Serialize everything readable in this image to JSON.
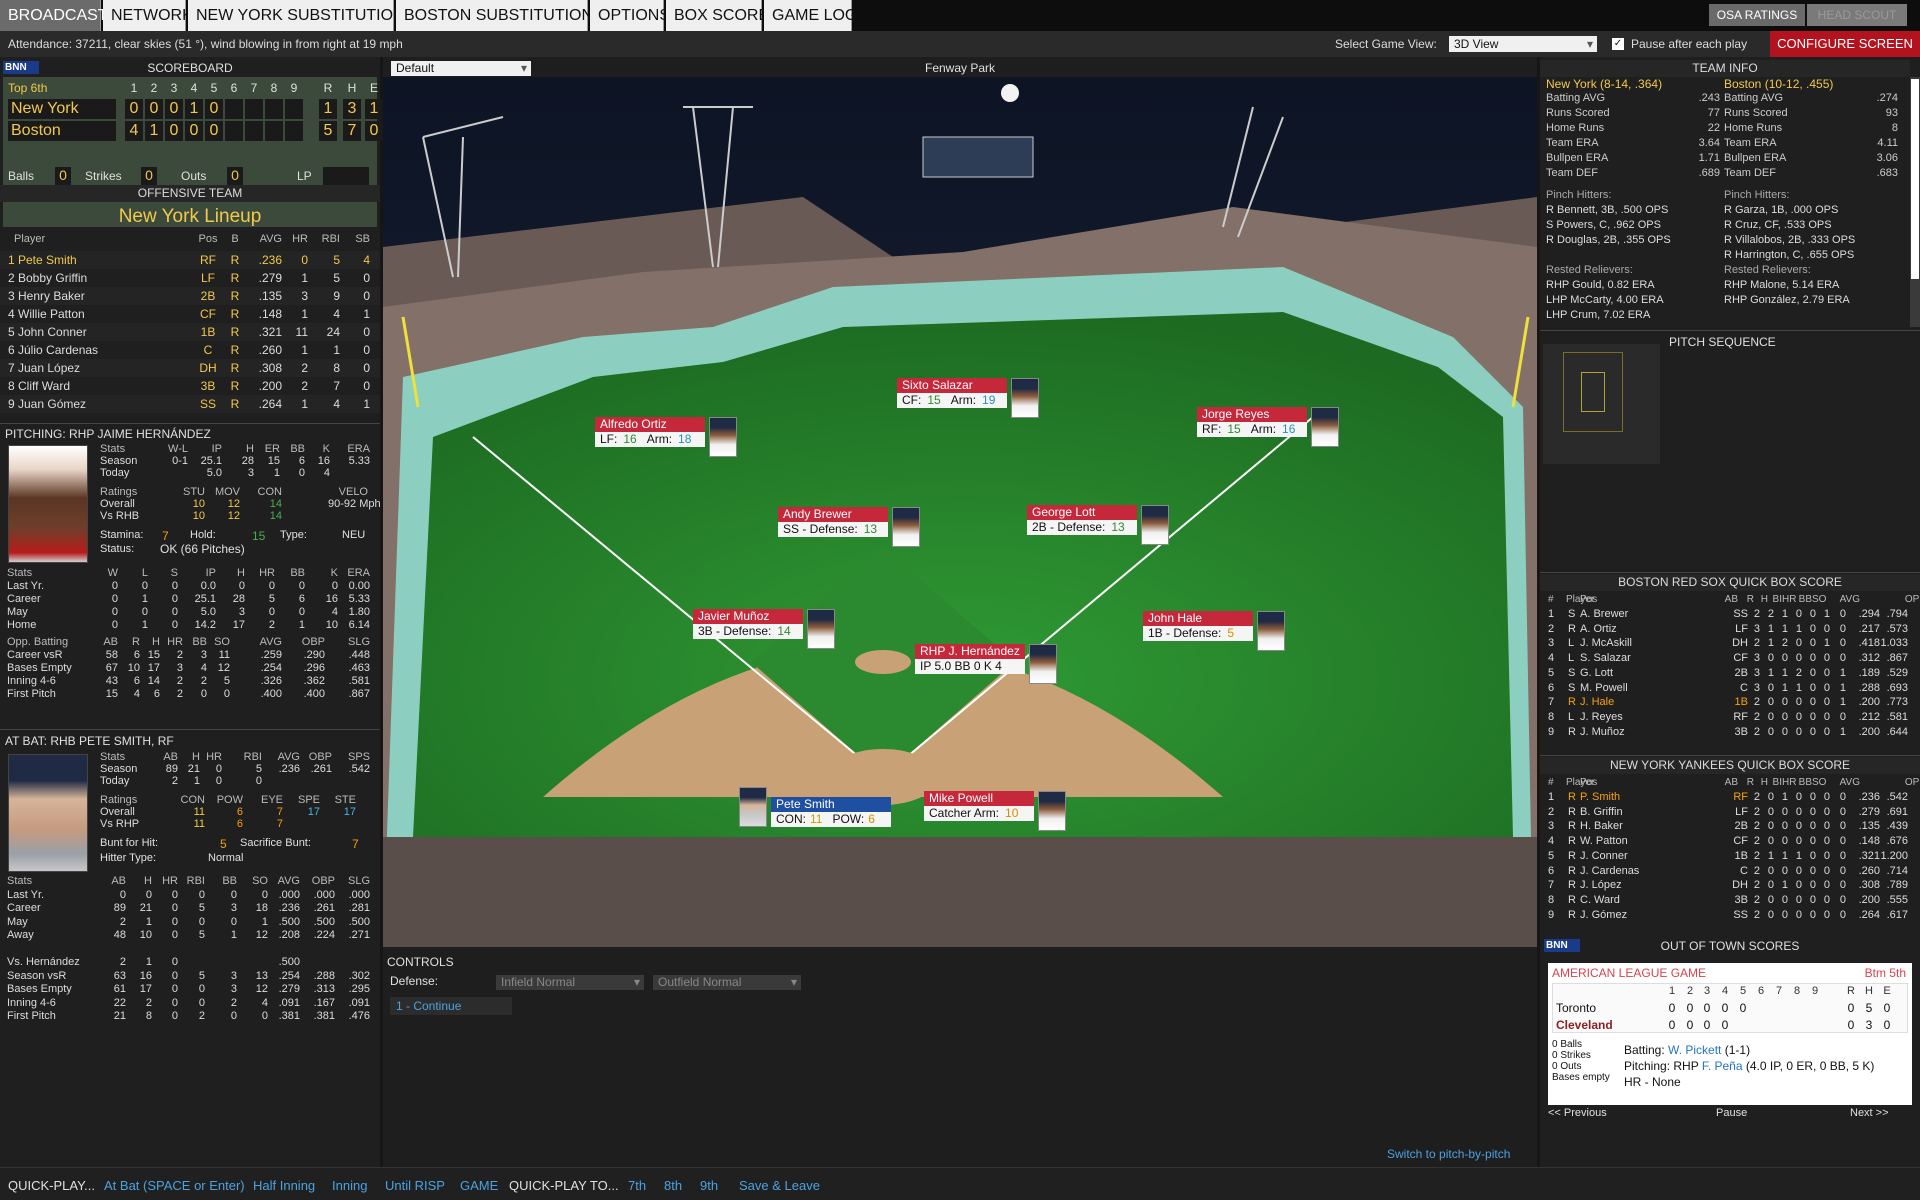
{
  "nav": {
    "tabs": [
      "BROADCAST",
      "NETWORK",
      "NEW YORK SUBSTITUTIONS",
      "BOSTON SUBSTITUTIONS",
      "OPTIONS",
      "BOX SCORE",
      "GAME LOG"
    ],
    "osa": "OSA RATINGS",
    "headscout": "HEAD SCOUT"
  },
  "attendance": "Attendance: 37211, clear skies (51 °), wind blowing in from right at 19 mph",
  "view": {
    "label": "Select Game View:",
    "value": "3D View",
    "pause": "Pause after each play",
    "configure": "CONFIGURE SCREEN"
  },
  "field": {
    "preset": "Default",
    "title": "Fenway Park"
  },
  "logo": "BNN",
  "scoreboard": {
    "title": "SCOREBOARD",
    "inning": "Top 6th",
    "cols": [
      "1",
      "2",
      "3",
      "4",
      "5",
      "6",
      "7",
      "8",
      "9",
      "R",
      "H",
      "E"
    ],
    "teams": [
      {
        "name": "New York",
        "runs": [
          "0",
          "0",
          "0",
          "1",
          "0",
          "",
          "",
          "",
          ""
        ],
        "rhe": [
          "1",
          "3",
          "1"
        ]
      },
      {
        "name": "Boston",
        "runs": [
          "4",
          "1",
          "0",
          "0",
          "0",
          "",
          "",
          "",
          ""
        ],
        "rhe": [
          "5",
          "7",
          "0"
        ]
      }
    ],
    "balls_l": "Balls",
    "balls": "0",
    "strikes_l": "Strikes",
    "strikes": "0",
    "outs_l": "Outs",
    "outs": "0",
    "lp": "LP"
  },
  "offense": {
    "title": "OFFENSIVE TEAM",
    "team": "New York Lineup",
    "cols": [
      "Player",
      "Pos",
      "B",
      "AVG",
      "HR",
      "RBI",
      "SB"
    ],
    "rows": [
      [
        "1 Pete Smith",
        "RF",
        "R",
        ".236",
        "0",
        "5",
        "4"
      ],
      [
        "2 Bobby Griffin",
        "LF",
        "R",
        ".279",
        "1",
        "5",
        "0"
      ],
      [
        "3 Henry Baker",
        "2B",
        "R",
        ".135",
        "3",
        "9",
        "0"
      ],
      [
        "4 Willie Patton",
        "CF",
        "R",
        ".148",
        "1",
        "4",
        "1"
      ],
      [
        "5 John Conner",
        "1B",
        "R",
        ".321",
        "11",
        "24",
        "0"
      ],
      [
        "6 Júlio Cardenas",
        "C",
        "R",
        ".260",
        "1",
        "1",
        "0"
      ],
      [
        "7 Juan López",
        "DH",
        "R",
        ".308",
        "2",
        "8",
        "0"
      ],
      [
        "8 Cliff Ward",
        "3B",
        "R",
        ".200",
        "2",
        "7",
        "0"
      ],
      [
        "9 Juan Gómez",
        "SS",
        "R",
        ".264",
        "1",
        "4",
        "1"
      ]
    ]
  },
  "pitching": {
    "title": "PITCHING: RHP JAIME HERNÁNDEZ",
    "s_cols": [
      "Stats",
      "W-L",
      "IP",
      "H",
      "ER",
      "BB",
      "K",
      "ERA"
    ],
    "s_rows": [
      [
        "Season",
        "0-1",
        "25.1",
        "28",
        "15",
        "6",
        "16",
        "5.33"
      ],
      [
        "Today",
        "",
        "5.0",
        "3",
        "1",
        "0",
        "4",
        ""
      ]
    ],
    "r_cols": [
      "Ratings",
      "STU",
      "MOV",
      "CON",
      "VELO"
    ],
    "r_rows": [
      [
        "Overall",
        "10",
        "12",
        "14",
        "90-92 Mph"
      ],
      [
        "Vs RHB",
        "10",
        "12",
        "14",
        ""
      ]
    ],
    "stamina_l": "Stamina:",
    "stamina": "7",
    "hold_l": "Hold:",
    "hold": "15",
    "type_l": "Type:",
    "type": "NEU",
    "status_l": "Status:",
    "status": "OK (66 Pitches)",
    "st_cols": [
      "Stats",
      "W",
      "L",
      "S",
      "IP",
      "H",
      "HR",
      "BB",
      "K",
      "ERA"
    ],
    "st_rows": [
      [
        "Last Yr.",
        "0",
        "0",
        "0",
        "0.0",
        "0",
        "0",
        "0",
        "0",
        "0.00"
      ],
      [
        "Career",
        "0",
        "1",
        "0",
        "25.1",
        "28",
        "5",
        "6",
        "16",
        "5.33"
      ],
      [
        "May",
        "0",
        "0",
        "0",
        "5.0",
        "3",
        "0",
        "0",
        "4",
        "1.80"
      ],
      [
        "Home",
        "0",
        "1",
        "0",
        "14.2",
        "17",
        "2",
        "1",
        "10",
        "6.14"
      ]
    ],
    "ob_cols": [
      "Opp. Batting",
      "AB",
      "R",
      "H",
      "HR",
      "BB",
      "SO",
      "AVG",
      "OBP",
      "SLG"
    ],
    "ob_rows": [
      [
        "Career vsR",
        "58",
        "6",
        "15",
        "2",
        "3",
        "11",
        ".259",
        ".290",
        ".448"
      ],
      [
        "Bases Empty",
        "67",
        "10",
        "17",
        "3",
        "4",
        "12",
        ".254",
        ".296",
        ".463"
      ],
      [
        "Inning 4-6",
        "43",
        "6",
        "14",
        "2",
        "2",
        "5",
        ".326",
        ".362",
        ".581"
      ],
      [
        "First Pitch",
        "15",
        "4",
        "6",
        "2",
        "0",
        "0",
        ".400",
        ".400",
        ".867"
      ]
    ]
  },
  "atbat": {
    "title": "AT BAT: RHB PETE SMITH, RF",
    "s_cols": [
      "Stats",
      "AB",
      "H",
      "HR",
      "RBI",
      "AVG",
      "OBP",
      "SPS"
    ],
    "s_rows": [
      [
        "Season",
        "89",
        "21",
        "0",
        "5",
        ".236",
        ".261",
        ".542"
      ],
      [
        "Today",
        "2",
        "1",
        "0",
        "0",
        "",
        "",
        ""
      ]
    ],
    "r_cols": [
      "Ratings",
      "CON",
      "POW",
      "EYE",
      "SPE",
      "STE"
    ],
    "r_rows": [
      [
        "Overall",
        "11",
        "6",
        "7",
        "17",
        "17"
      ],
      [
        "Vs RHP",
        "11",
        "6",
        "7",
        "",
        ""
      ]
    ],
    "bunt_l": "Bunt for Hit:",
    "bunt": "5",
    "sac_l": "Sacrifice Bunt:",
    "sac": "7",
    "ht_l": "Hitter Type:",
    "ht": "Normal",
    "st_cols": [
      "Stats",
      "AB",
      "H",
      "HR",
      "RBI",
      "BB",
      "SO",
      "AVG",
      "OBP",
      "SLG"
    ],
    "st_rows": [
      [
        "Last Yr.",
        "0",
        "0",
        "0",
        "0",
        "0",
        "0",
        ".000",
        ".000",
        ".000"
      ],
      [
        "Career",
        "89",
        "21",
        "0",
        "5",
        "3",
        "18",
        ".236",
        ".261",
        ".281"
      ],
      [
        "May",
        "2",
        "1",
        "0",
        "0",
        "0",
        "1",
        ".500",
        ".500",
        ".500"
      ],
      [
        "Away",
        "48",
        "10",
        "0",
        "5",
        "1",
        "12",
        ".208",
        ".224",
        ".271"
      ],
      [
        "",
        "",
        "",
        "",
        "",
        "",
        "",
        "",
        "",
        ""
      ],
      [
        "Vs. Hernández",
        "2",
        "1",
        "0",
        "",
        "",
        "",
        ".500",
        "",
        ""
      ],
      [
        "Season vsR",
        "63",
        "16",
        "0",
        "5",
        "3",
        "13",
        ".254",
        ".288",
        ".302"
      ],
      [
        "Bases Empty",
        "61",
        "17",
        "0",
        "0",
        "3",
        "12",
        ".279",
        ".313",
        ".295"
      ],
      [
        "Inning 4-6",
        "22",
        "2",
        "0",
        "0",
        "2",
        "4",
        ".091",
        ".167",
        ".091"
      ],
      [
        "First Pitch",
        "21",
        "8",
        "0",
        "2",
        "0",
        "0",
        ".381",
        ".381",
        ".476"
      ]
    ]
  },
  "fielders": [
    {
      "name": "Sixto Salazar",
      "stat": "CF:",
      "v1": "15",
      "a": "Arm:",
      "v2": "19"
    },
    {
      "name": "Alfredo Ortiz",
      "stat": "LF:",
      "v1": "16",
      "a": "Arm:",
      "v2": "18"
    },
    {
      "name": "Jorge Reyes",
      "stat": "RF:",
      "v1": "15",
      "a": "Arm:",
      "v2": "16"
    },
    {
      "name": "Andy Brewer",
      "stat": "SS - Defense:",
      "v1": "13",
      "a": "",
      "v2": ""
    },
    {
      "name": "George Lott",
      "stat": "2B - Defense:",
      "v1": "13",
      "a": "",
      "v2": ""
    },
    {
      "name": "Javier Muñoz",
      "stat": "3B - Defense:",
      "v1": "14",
      "a": "",
      "v2": ""
    },
    {
      "name": "John Hale",
      "stat": "1B - Defense:",
      "v1": "5",
      "a": "",
      "v2": ""
    },
    {
      "name": "RHP J. Hernández",
      "stat": "IP 5.0  BB 0  K 4",
      "v1": "",
      "a": "",
      "v2": ""
    },
    {
      "name": "Mike Powell",
      "stat": "Catcher Arm:",
      "v1": "10",
      "a": "",
      "v2": ""
    }
  ],
  "batter": {
    "name": "Pete Smith",
    "con_l": "CON:",
    "con": "11",
    "pow_l": "POW:",
    "pow": "6"
  },
  "controls": {
    "title": "CONTROLS",
    "defense_l": "Defense:",
    "infield": "Infield Normal",
    "outfield": "Outfield Normal",
    "continue": "1 - Continue",
    "switch": "Switch to pitch-by-pitch"
  },
  "teaminfo": {
    "title": "TEAM INFO",
    "ny": {
      "head": "New York (8-14, .364)",
      "rows": [
        [
          "Batting AVG",
          ".243"
        ],
        [
          "Runs Scored",
          "77"
        ],
        [
          "Home Runs",
          "22"
        ],
        [
          "Team ERA",
          "3.64"
        ],
        [
          "Bullpen ERA",
          "1.71"
        ],
        [
          "Team DEF",
          ".689"
        ]
      ],
      "ph_l": "Pinch Hitters:",
      "ph": [
        "R Bennett, 3B, .500 OPS",
        "S Powers, C, .962 OPS",
        "R Douglas, 2B, .355 OPS"
      ],
      "rr_l": "Rested Relievers:",
      "rr": [
        "RHP Gould, 0.82 ERA",
        "LHP McCarty, 4.00 ERA",
        "LHP Crum, 7.02 ERA"
      ]
    },
    "bos": {
      "head": "Boston (10-12, .455)",
      "rows": [
        [
          "Batting AVG",
          ".274"
        ],
        [
          "Runs Scored",
          "93"
        ],
        [
          "Home Runs",
          "8"
        ],
        [
          "Team ERA",
          "4.11"
        ],
        [
          "Bullpen ERA",
          "3.06"
        ],
        [
          "Team DEF",
          ".683"
        ]
      ],
      "ph_l": "Pinch Hitters:",
      "ph": [
        "R Garza, 1B, .000 OPS",
        "R Cruz, CF, .533 OPS",
        "R Villalobos, 2B, .333 OPS",
        "R Harrington, C, .655 OPS"
      ],
      "rr_l": "Rested Relievers:",
      "rr": [
        "RHP Malone, 5.14 ERA",
        "RHP González, 2.79 ERA"
      ]
    }
  },
  "pitchseq": {
    "title": "PITCH SEQUENCE"
  },
  "box_cols": [
    "#",
    "Player",
    "Pos",
    "AB",
    "R",
    "H",
    "BI",
    "HR",
    "BB",
    "SO",
    "AVG",
    "OPS"
  ],
  "bos_box": {
    "title": "BOSTON RED SOX QUICK BOX SCORE",
    "rows": [
      [
        "1",
        "S",
        "A. Brewer",
        "SS",
        "2",
        "2",
        "1",
        "0",
        "0",
        "1",
        "0",
        ".294",
        ".794"
      ],
      [
        "2",
        "R",
        "A. Ortiz",
        "LF",
        "3",
        "1",
        "1",
        "1",
        "0",
        "0",
        "0",
        ".217",
        ".573"
      ],
      [
        "3",
        "L",
        "J. McAskill",
        "DH",
        "2",
        "1",
        "2",
        "0",
        "0",
        "1",
        "0",
        ".418",
        "1.033"
      ],
      [
        "4",
        "L",
        "S. Salazar",
        "CF",
        "3",
        "0",
        "0",
        "0",
        "0",
        "0",
        "0",
        ".312",
        ".867"
      ],
      [
        "5",
        "S",
        "G. Lott",
        "2B",
        "3",
        "1",
        "1",
        "2",
        "0",
        "0",
        "1",
        ".189",
        ".529"
      ],
      [
        "6",
        "S",
        "M. Powell",
        "C",
        "3",
        "0",
        "1",
        "1",
        "0",
        "0",
        "1",
        ".288",
        ".693"
      ],
      [
        "7",
        "R",
        "J. Hale",
        "1B",
        "2",
        "0",
        "0",
        "0",
        "0",
        "0",
        "1",
        ".200",
        ".773"
      ],
      [
        "8",
        "L",
        "J. Reyes",
        "RF",
        "2",
        "0",
        "0",
        "0",
        "0",
        "0",
        "0",
        ".212",
        ".581"
      ],
      [
        "9",
        "R",
        "J. Muñoz",
        "3B",
        "2",
        "0",
        "0",
        "0",
        "0",
        "0",
        "1",
        ".200",
        ".644"
      ]
    ]
  },
  "ny_box": {
    "title": "NEW YORK YANKEES QUICK BOX SCORE",
    "rows": [
      [
        "1",
        "R",
        "P. Smith",
        "RF",
        "2",
        "0",
        "1",
        "0",
        "0",
        "0",
        "0",
        ".236",
        ".542"
      ],
      [
        "2",
        "R",
        "B. Griffin",
        "LF",
        "2",
        "0",
        "0",
        "0",
        "0",
        "0",
        "0",
        ".279",
        ".691"
      ],
      [
        "3",
        "R",
        "H. Baker",
        "2B",
        "2",
        "0",
        "0",
        "0",
        "0",
        "0",
        "0",
        ".135",
        ".439"
      ],
      [
        "4",
        "R",
        "W. Patton",
        "CF",
        "2",
        "0",
        "0",
        "0",
        "0",
        "0",
        "0",
        ".148",
        ".676"
      ],
      [
        "5",
        "R",
        "J. Conner",
        "1B",
        "2",
        "1",
        "1",
        "1",
        "0",
        "0",
        "0",
        ".321",
        "1.200"
      ],
      [
        "6",
        "R",
        "J. Cardenas",
        "C",
        "2",
        "0",
        "0",
        "0",
        "0",
        "0",
        "0",
        ".260",
        ".714"
      ],
      [
        "7",
        "R",
        "J. López",
        "DH",
        "2",
        "0",
        "1",
        "0",
        "0",
        "0",
        "0",
        ".308",
        ".789"
      ],
      [
        "8",
        "R",
        "C. Ward",
        "3B",
        "2",
        "0",
        "0",
        "0",
        "0",
        "0",
        "0",
        ".200",
        ".555"
      ],
      [
        "9",
        "R",
        "J. Gómez",
        "SS",
        "2",
        "0",
        "0",
        "0",
        "0",
        "0",
        "0",
        ".264",
        ".617"
      ]
    ]
  },
  "oot": {
    "title": "OUT OF TOWN SCORES",
    "league": "AMERICAN LEAGUE GAME",
    "inning": "Btm 5th",
    "cols": [
      "1",
      "2",
      "3",
      "4",
      "5",
      "6",
      "7",
      "8",
      "9",
      "R",
      "H",
      "E"
    ],
    "teams": [
      {
        "name": "Toronto",
        "runs": [
          "0",
          "0",
          "0",
          "0",
          "0",
          "",
          "",
          "",
          ""
        ],
        "rhe": [
          "0",
          "5",
          "0"
        ]
      },
      {
        "name": "Cleveland",
        "runs": [
          "0",
          "0",
          "0",
          "0",
          "",
          "",
          "",
          "",
          ""
        ],
        "rhe": [
          "0",
          "3",
          "0"
        ]
      }
    ],
    "count": [
      "0 Balls",
      "0 Strikes",
      "0 Outs",
      "Bases empty"
    ],
    "batting_l": "Batting:",
    "batting": "W. Pickett",
    "batting_rec": "(1-1)",
    "pitching_l": "Pitching: RHP",
    "pitching": "F. Peña",
    "pitching_rec": "(4.0 IP, 0 ER, 0 BB, 5 K)",
    "hr": "HR - None",
    "prev": "<< Previous",
    "pause": "Pause",
    "next": "Next >>"
  },
  "bottom": {
    "qp": "QUICK-PLAY...",
    "items": [
      "At Bat (SPACE or Enter)",
      "Half Inning",
      "Inning",
      "Until RISP",
      "GAME"
    ],
    "qpt": "QUICK-PLAY TO...",
    "to": [
      "7th",
      "8th",
      "9th"
    ],
    "save": "Save & Leave"
  }
}
